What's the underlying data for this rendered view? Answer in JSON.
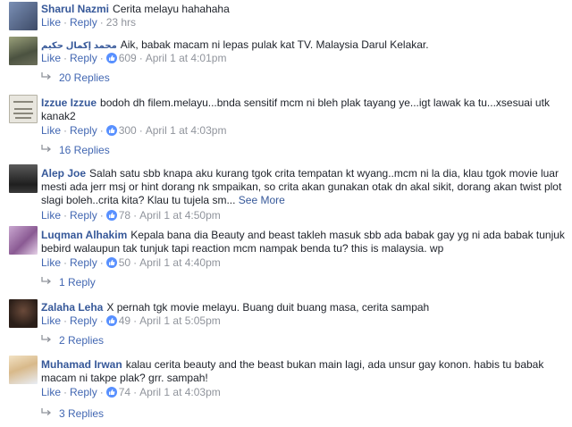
{
  "colors": {
    "link": "#365899",
    "action": "#4267b2",
    "meta": "#90949c",
    "like": "#5890ff"
  },
  "action_labels": {
    "like": "Like",
    "reply": "Reply"
  },
  "comments": [
    {
      "author": "Sharul Nazmi",
      "text": "Cerita melayu hahahaha",
      "likes": "",
      "time": "23 hrs",
      "replies": "",
      "see_more": ""
    },
    {
      "author": "محمد إكمال حكيم",
      "text": "Aik, babak macam ni lepas pulak kat TV. Malaysia Darul Kelakar.",
      "likes": "609",
      "time": "April 1 at 4:01pm",
      "replies": "20 Replies",
      "see_more": ""
    },
    {
      "author": "Izzue Izzue",
      "text": "bodoh dh filem.melayu...bnda sensitif mcm ni bleh plak tayang ye...igt lawak ka tu...xsesuai utk kanak2",
      "likes": "300",
      "time": "April 1 at 4:03pm",
      "replies": "16 Replies",
      "see_more": ""
    },
    {
      "author": "Alep Joe",
      "text": "Salah satu sbb knapa aku kurang tgok crita tempatan kt wyang..mcm ni la dia, klau tgok movie luar mesti ada jerr msj or hint dorang nk smpaikan, so crita akan gunakan otak dn akal sikit, dorang akan twist plot slagi boleh..crita kita? Klau tu tujela sm...",
      "likes": "78",
      "time": "April 1 at 4:50pm",
      "replies": "",
      "see_more": "See More"
    },
    {
      "author": "Luqman Alhakim",
      "text": "Kepala bana dia Beauty and beast takleh masuk sbb ada babak gay yg ni ada babak tunjuk bebird walaupun tak tunjuk tapi reaction mcm nampak benda tu? this is malaysia. wp",
      "likes": "50",
      "time": "April 1 at 4:40pm",
      "replies": "1 Reply",
      "see_more": ""
    },
    {
      "author": "Zalaha Leha",
      "text": "X pernah tgk movie melayu. Buang duit buang masa, cerita sampah",
      "likes": "49",
      "time": "April 1 at 5:05pm",
      "replies": "2 Replies",
      "see_more": ""
    },
    {
      "author": "Muhamad Irwan",
      "text": "kalau cerita beauty and the beast bukan main lagi, ada unsur gay konon. habis tu babak macam ni takpe plak? grr. sampah!",
      "likes": "74",
      "time": "April 1 at 4:03pm",
      "replies": "3 Replies",
      "see_more": ""
    }
  ]
}
